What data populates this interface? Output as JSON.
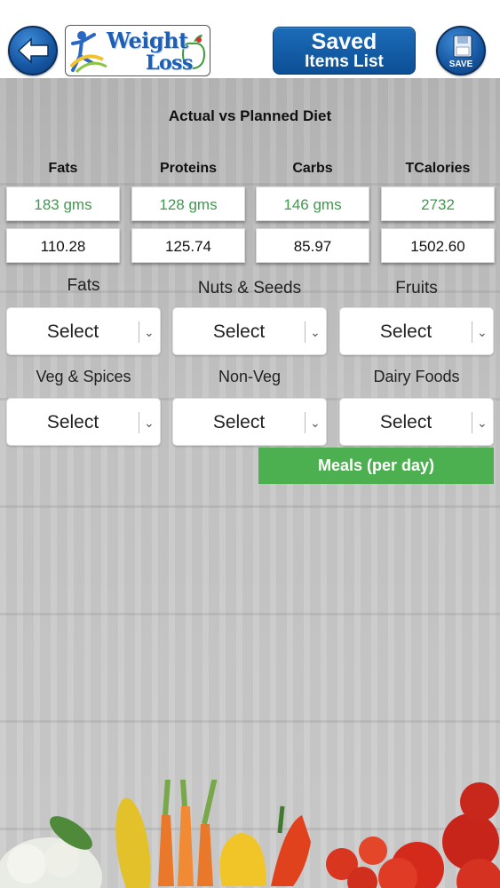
{
  "header": {
    "logo_word1": "Weight",
    "logo_word2": "Loss",
    "saved_line1": "Saved",
    "saved_line2": "Items List",
    "save_label": "SAVE"
  },
  "summary": {
    "title": "Actual vs Planned Diet",
    "columns": [
      {
        "label": "Fats",
        "planned": "183 gms",
        "actual": "110.28"
      },
      {
        "label": "Proteins",
        "planned": "128 gms",
        "actual": "125.74"
      },
      {
        "label": "Carbs",
        "planned": "146 gms",
        "actual": "85.97"
      },
      {
        "label": "TCalories",
        "planned": "2732",
        "actual": "1502.60"
      }
    ]
  },
  "selectors": [
    {
      "label": "Fats",
      "value": "Select"
    },
    {
      "label": "Nuts & Seeds",
      "value": "Select"
    },
    {
      "label": "Fruits",
      "value": "Select"
    },
    {
      "label": "Veg & Spices",
      "value": "Select"
    },
    {
      "label": "Non-Veg",
      "value": "Select"
    },
    {
      "label": "Dairy Foods",
      "value": "Select"
    }
  ],
  "meals_button": "Meals (per day)",
  "colors": {
    "header_blue": "#0c4f96",
    "planned_green": "#3f9a4e",
    "meals_green": "#4caf50"
  },
  "icons": [
    "back-arrow-icon",
    "weight-loss-logo-icon",
    "floppy-disk-icon",
    "chevron-down-icon"
  ]
}
